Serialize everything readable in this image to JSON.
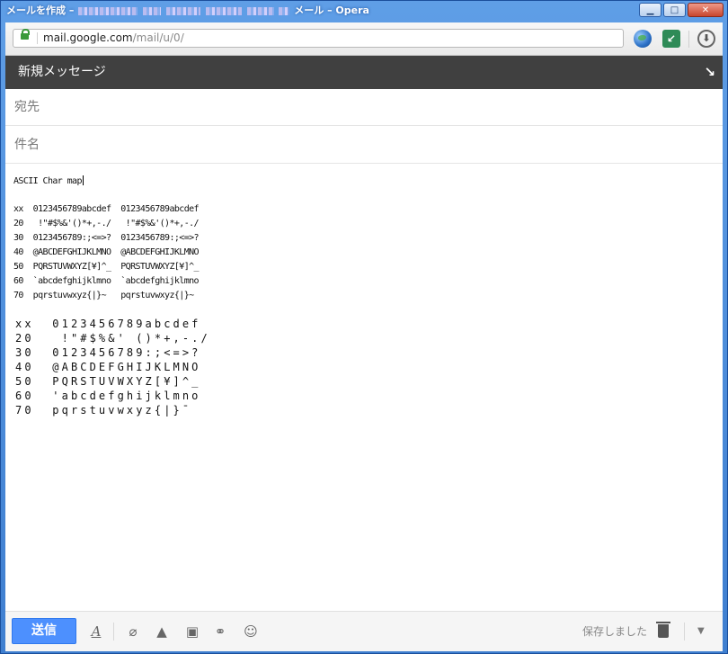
{
  "window": {
    "title_prefix": "メールを作成 –",
    "title_suffix": "メール – Opera",
    "buttons": {
      "minimize": "▁",
      "maximize": "□",
      "close": "✕"
    }
  },
  "browser": {
    "url_host": "mail.google.com",
    "url_path": "/mail/u/0/"
  },
  "compose": {
    "header_title": "新規メッセージ",
    "popout_icon": "↘",
    "to_label": "宛先",
    "subject_label": "件名",
    "body_first_line": "ASCII Char map",
    "table_small": [
      "xx  0123456789abcdef  0123456789abcdef",
      "20   !\"#$%&'()*+,-./   !\"#$%&'()*+,-./",
      "30  0123456789:;<=>?  0123456789:;<=>?",
      "40  @ABCDEFGHIJKLMNO  @ABCDEFGHIJKLMNO",
      "50  PQRSTUVWXYZ[¥]^_  PQRSTUVWXYZ[¥]^_",
      "60  `abcdefghijklmno  `abcdefghijklmno",
      "70  pqrstuvwxyz{|}~   pqrstuvwxyz{|}~"
    ],
    "table_wide": [
      "xx  0123456789abcdef",
      "20   !\"#$%&' ()*+,-./",
      "30  0123456789:;<=>?",
      "40  @ABCDEFGHIJKLMNO",
      "50  PQRSTUVWXYZ[¥]^_",
      "60  'abcdefghijklmno",
      "70  pqrstuvwxyz{|}¯"
    ]
  },
  "bottom_bar": {
    "send_label": "送信",
    "saved_label": "保存しました",
    "icons": [
      "format-text-icon",
      "attach-icon",
      "drive-icon",
      "photo-icon",
      "link-icon",
      "emoji-icon",
      "trash-icon",
      "more-options-icon"
    ]
  }
}
